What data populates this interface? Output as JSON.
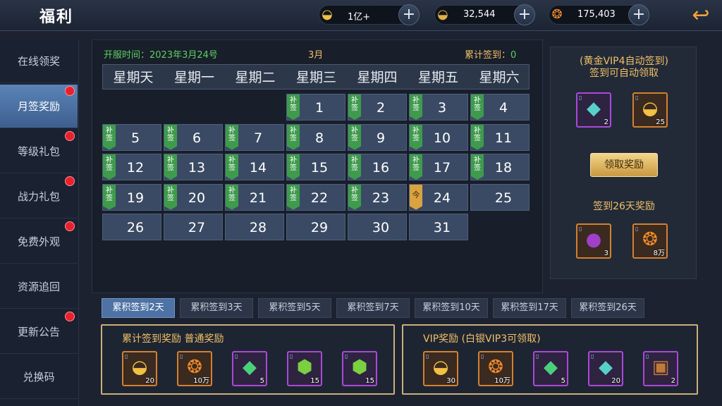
{
  "window": {
    "title": "福利"
  },
  "currencies": [
    {
      "icon": "gold-ingot-icon",
      "value": "1亿+"
    },
    {
      "icon": "bound-gold-ingot-icon",
      "value": "32,544"
    },
    {
      "icon": "coin-string-icon",
      "value": "175,403"
    }
  ],
  "sidebar": {
    "items": [
      {
        "label": "在线领奖",
        "dot": false,
        "active": false
      },
      {
        "label": "月签奖励",
        "dot": true,
        "active": true
      },
      {
        "label": "等级礼包",
        "dot": true,
        "active": false
      },
      {
        "label": "战力礼包",
        "dot": true,
        "active": false
      },
      {
        "label": "免费外观",
        "dot": true,
        "active": false
      },
      {
        "label": "资源追回",
        "dot": false,
        "active": false
      },
      {
        "label": "更新公告",
        "dot": true,
        "active": false
      },
      {
        "label": "兑换码",
        "dot": false,
        "active": false
      }
    ]
  },
  "calendar": {
    "server_open": "开服时间：2023年3月24号",
    "month": "3月",
    "total_label": "累计签到：",
    "total_value": "0",
    "weekdays": [
      "星期天",
      "星期一",
      "星期二",
      "星期三",
      "星期四",
      "星期五",
      "星期六"
    ],
    "makeup_tag": "补签",
    "today_tag": "今",
    "today": 24,
    "first_weekday": 3,
    "days": 31,
    "makeup_days": [
      1,
      2,
      3,
      4,
      5,
      6,
      7,
      8,
      9,
      10,
      11,
      12,
      13,
      14,
      15,
      16,
      17,
      18,
      19,
      20,
      21,
      22,
      23
    ]
  },
  "vip_auto": {
    "title": "(黄金VIP4自动签到)",
    "subtitle": "签到可自动领取",
    "items": [
      {
        "icon": "wing-crystal-icon",
        "qty": "2",
        "rarity": "purple"
      },
      {
        "icon": "gold-ingot-icon",
        "qty": "25",
        "rarity": "orange"
      }
    ],
    "claim_button": "领取奖励"
  },
  "day26": {
    "title": "签到26天奖励",
    "items": [
      {
        "icon": "purple-orb-icon",
        "qty": "3",
        "rarity": "orange"
      },
      {
        "icon": "coin-string-icon",
        "qty": "8万",
        "rarity": "orange"
      }
    ]
  },
  "tabs": [
    "累积签到2天",
    "累积签到3天",
    "累积签到5天",
    "累积签到7天",
    "累积签到10天",
    "累积签到17天",
    "累积签到26天"
  ],
  "normal_reward": {
    "title": "累计签到奖励  普通奖励",
    "items": [
      {
        "icon": "gold-ingot-icon",
        "qty": "20",
        "rarity": "orange"
      },
      {
        "icon": "coin-string-icon",
        "qty": "10万",
        "rarity": "orange"
      },
      {
        "icon": "green-wing-crystal-icon",
        "qty": "5",
        "rarity": "purple"
      },
      {
        "icon": "green-ore-icon",
        "qty": "15",
        "rarity": "purple"
      },
      {
        "icon": "green-ore-icon",
        "qty": "15",
        "rarity": "purple"
      }
    ]
  },
  "vip_reward": {
    "title": "VIP奖励   (白银VIP3可领取)",
    "items": [
      {
        "icon": "gold-ingot-icon",
        "qty": "30",
        "rarity": "orange"
      },
      {
        "icon": "coin-string-icon",
        "qty": "10万",
        "rarity": "orange"
      },
      {
        "icon": "green-wing-crystal-icon",
        "qty": "5",
        "rarity": "purple"
      },
      {
        "icon": "wing-crystal-icon",
        "qty": "20",
        "rarity": "purple"
      },
      {
        "icon": "treasure-chest-icon",
        "qty": "2",
        "rarity": "purple"
      }
    ]
  }
}
